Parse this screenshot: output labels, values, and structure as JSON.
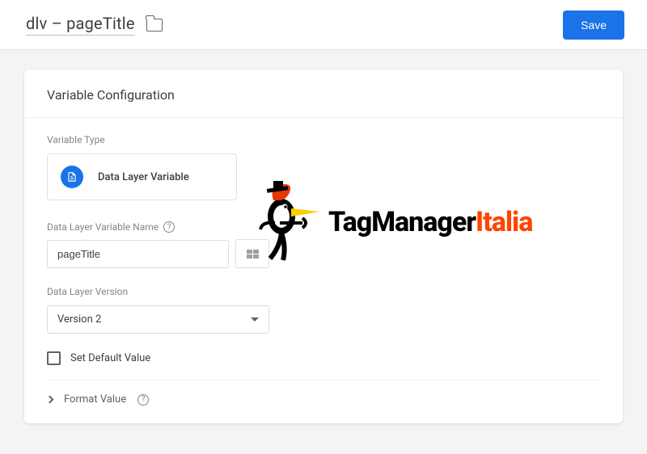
{
  "header": {
    "title": "dlv – pageTitle",
    "save_label": "Save"
  },
  "card": {
    "title": "Variable Configuration",
    "variable_type_label": "Variable Type",
    "variable_type_value": "Data Layer Variable",
    "dlv_name_label": "Data Layer Variable Name",
    "dlv_name_value": "pageTitle",
    "version_label": "Data Layer Version",
    "version_value": "Version 2",
    "set_default_label": "Set Default Value",
    "format_label": "Format Value"
  },
  "logo": {
    "part1": "TagManager",
    "part2": "Italia"
  }
}
